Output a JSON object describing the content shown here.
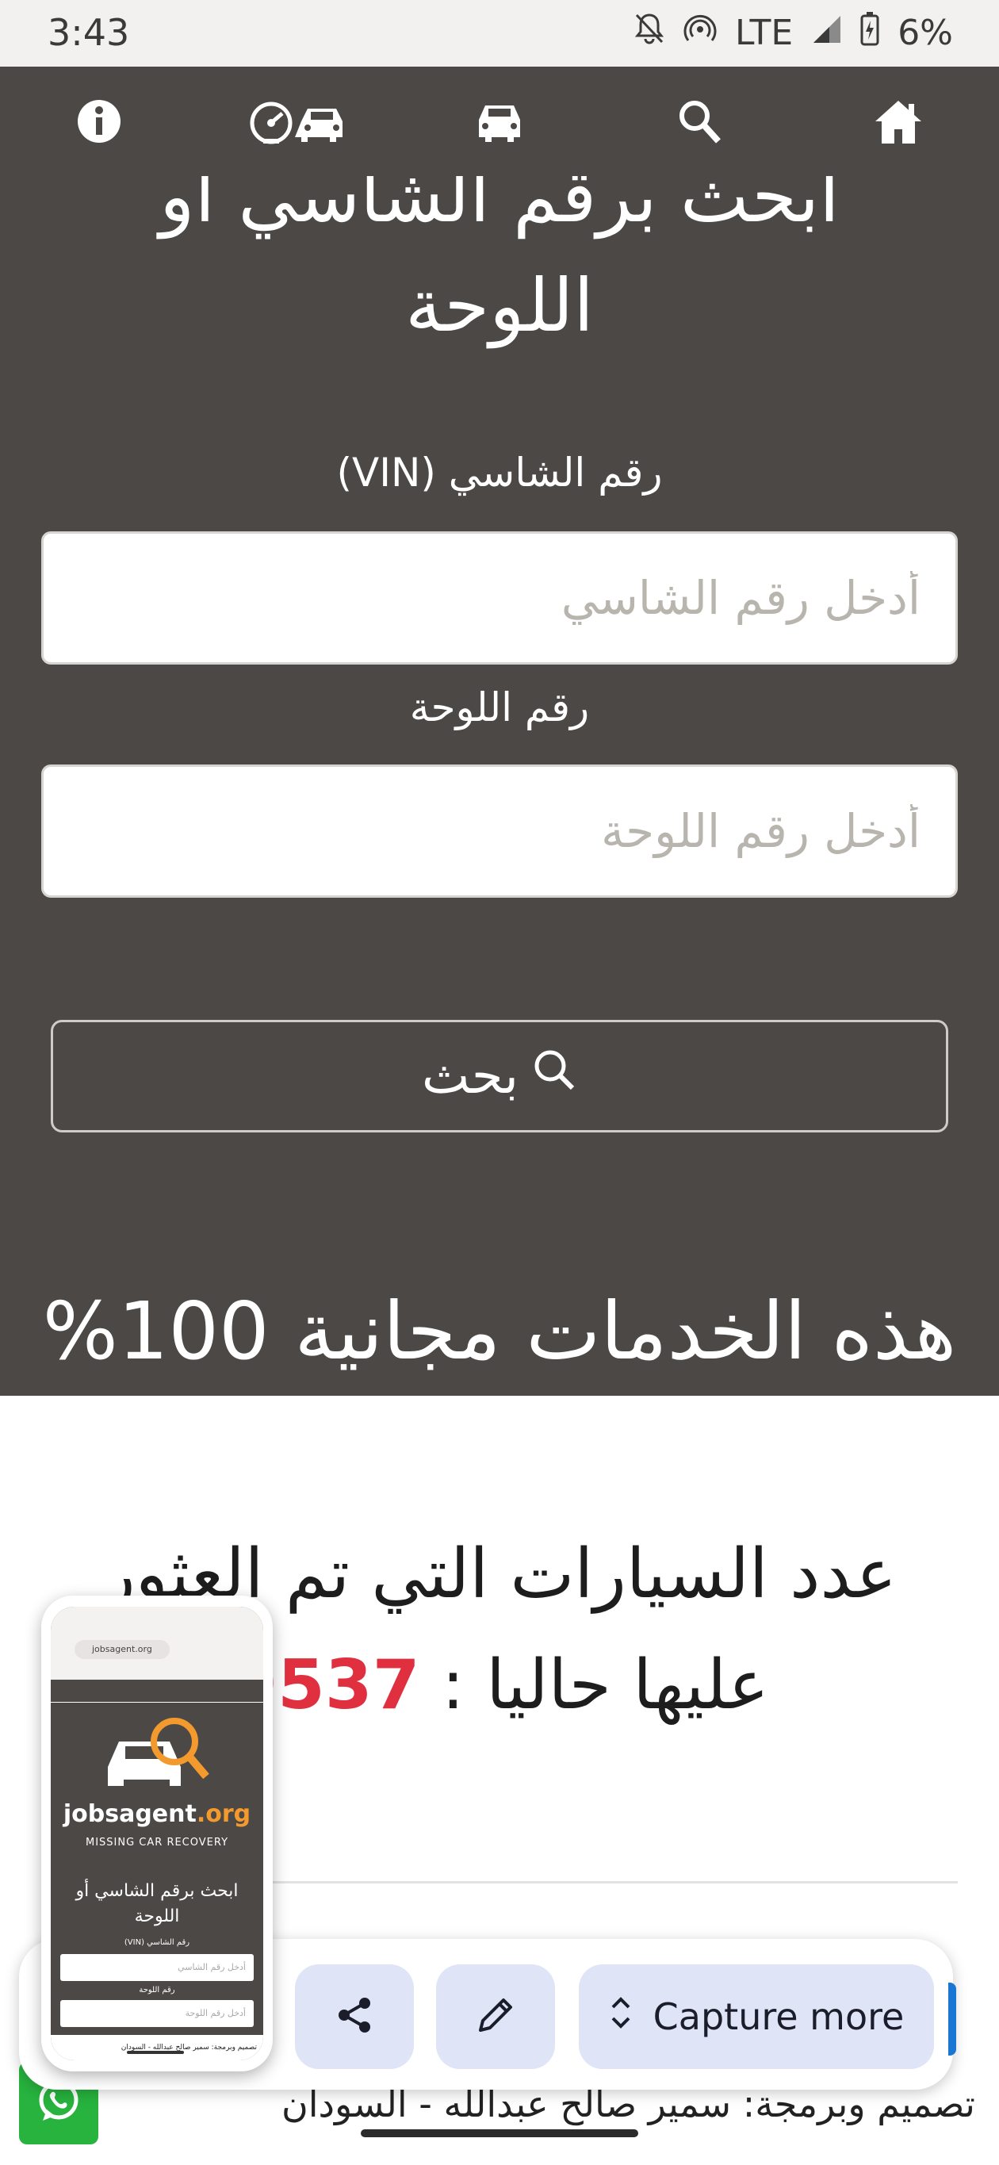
{
  "status_bar": {
    "time": "3:43",
    "network": "LTE",
    "battery": "6%"
  },
  "navbar": {
    "icons": [
      "info-icon",
      "speedometer-car-icon",
      "car-icon",
      "search-icon",
      "home-icon"
    ]
  },
  "hero": {
    "title_line1": "ابحث برقم الشاسي أو",
    "title_line2": "اللوحة",
    "vin_label": "رقم الشاسي (VIN)",
    "vin_placeholder": "أدخل رقم الشاسي",
    "plate_label": "رقم اللوحة",
    "plate_placeholder": "أدخل رقم اللوحة",
    "search_label": "بحث",
    "free_text": "هذه الخدمات مجانية 100%"
  },
  "counter": {
    "line1": "عدد السيارات التي تم العثور",
    "line2_prefix": "عليها حاليا : ",
    "number": "9537"
  },
  "footer": {
    "credit": "تصميم وبرمجة: سمير صالح عبدالله - السودان"
  },
  "capture_toolbar": {
    "capture_more_label": "Capture more"
  },
  "thumbnail": {
    "url": "jobsagent.org",
    "logo_main": "jobsagent",
    "logo_tld": ".org",
    "tagline": "MISSING CAR RECOVERY",
    "title_line1": "ابحث برقم الشاسي أو",
    "title_line2": "اللوحة",
    "vin_label": "رقم الشاسي (VIN)",
    "vin_placeholder": "أدخل رقم الشاسي",
    "plate_label": "رقم اللوحة",
    "plate_placeholder": "أدخل رقم اللوحة",
    "footer": "تصميم وبرمجة: سمير صالح عبدالله - السودان"
  },
  "colors": {
    "hero_bg": "#4b4845",
    "accent_red": "#e03040",
    "whatsapp_green": "#27b33e",
    "capture_btn_bg": "#dfe4f7",
    "logo_orange": "#f29a2e"
  }
}
